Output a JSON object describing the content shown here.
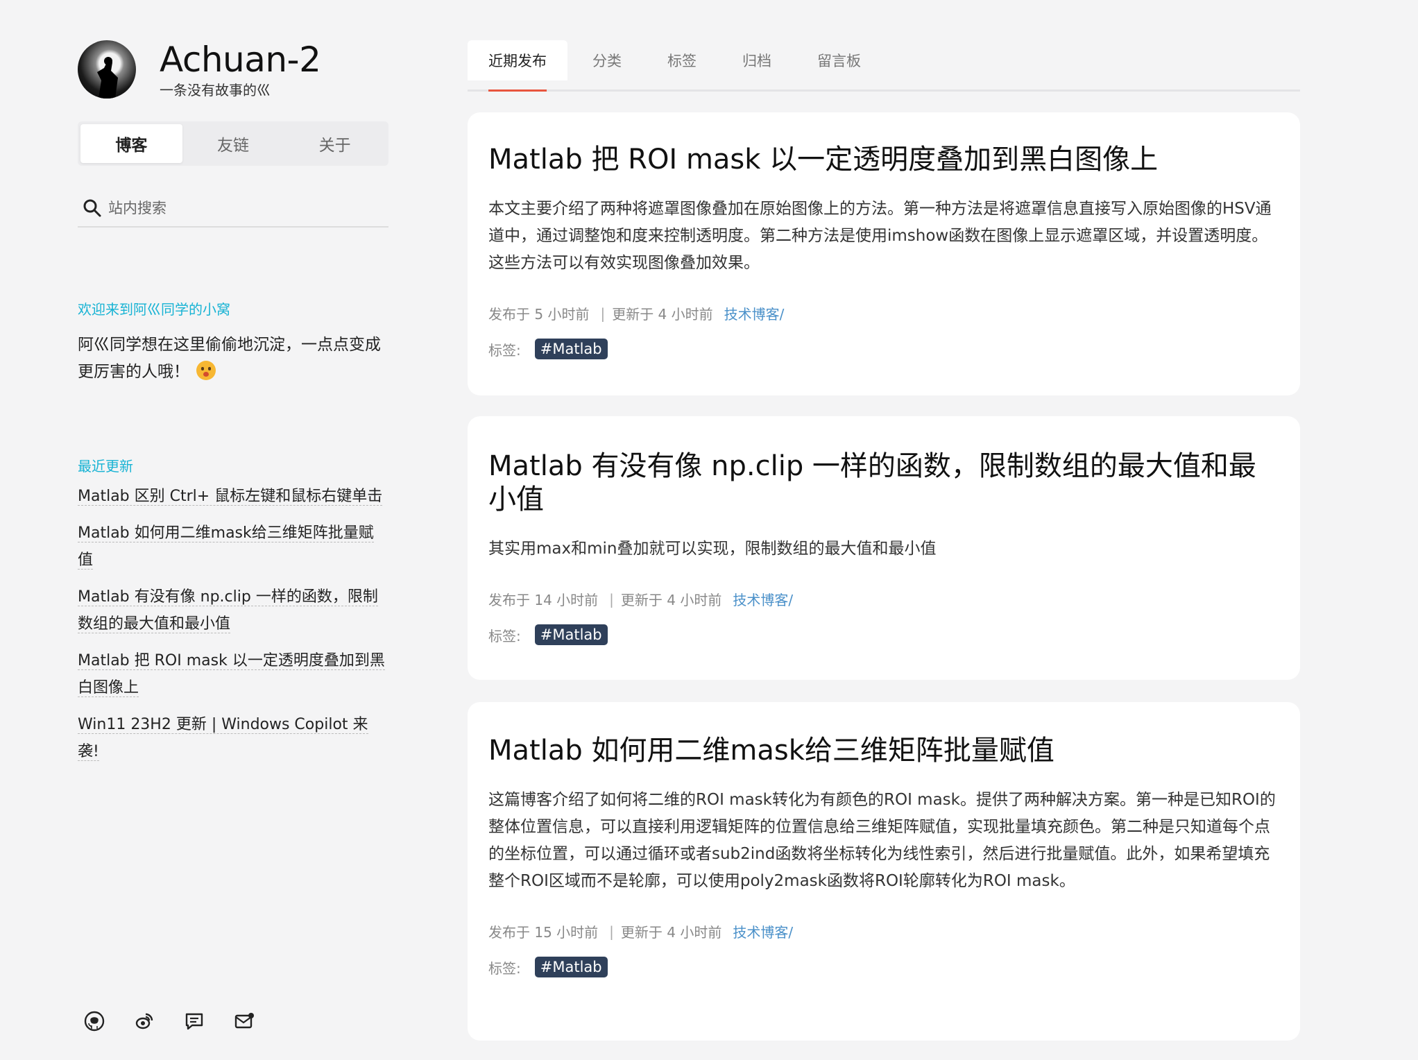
{
  "brand": {
    "title": "Achuan-2",
    "subtitle": "一条没有故事的巛"
  },
  "sidebar_nav": [
    "博客",
    "友链",
    "关于"
  ],
  "search": {
    "placeholder": "站内搜索"
  },
  "welcome": {
    "heading": "欢迎来到阿巛同学的小窝",
    "text": "阿巛同学想在这里偷偷地沉淀，一点点变成更厉害的人哦！"
  },
  "recent": {
    "heading": "最近更新",
    "items": [
      "Matlab 区别 Ctrl+ 鼠标左键和鼠标右键单击",
      "Matlab 如何用二维mask给三维矩阵批量赋值",
      "Matlab 有没有像 np.clip 一样的函数，限制数组的最大值和最小值",
      "Matlab 把 ROI mask 以一定透明度叠加到黑白图像上",
      "Win11 23H2 更新 | Windows Copilot 来袭!"
    ]
  },
  "social_icons": [
    "github-icon",
    "weibo-icon",
    "comment-icon",
    "mail-icon"
  ],
  "top_tabs": [
    "近期发布",
    "分类",
    "标签",
    "归档",
    "留言板"
  ],
  "labels": {
    "published_prefix": "发布于",
    "updated_prefix": "更新于",
    "tags_label": "标签:"
  },
  "posts": [
    {
      "title": "Matlab 把 ROI mask 以一定透明度叠加到黑白图像上",
      "excerpt": "本文主要介绍了两种将遮罩图像叠加在原始图像上的方法。第一种方法是将遮罩信息直接写入原始图像的HSV通道中，通过调整饱和度来控制透明度。第二种方法是使用imshow函数在图像上显示遮罩区域，并设置透明度。这些方法可以有效实现图像叠加效果。",
      "published": "发布于 5 小时前",
      "updated": "更新于 4 小时前",
      "category": "技术博客/",
      "tag": "#Matlab"
    },
    {
      "title": "Matlab 有没有像 np.clip 一样的函数，限制数组的最大值和最小值",
      "excerpt": "其实用max和min叠加就可以实现，限制数组的最大值和最小值",
      "published": "发布于 14 小时前",
      "updated": "更新于 4 小时前",
      "category": "技术博客/",
      "tag": "#Matlab"
    },
    {
      "title": "Matlab 如何用二维mask给三维矩阵批量赋值",
      "excerpt": "这篇博客介绍了如何将二维的ROI mask转化为有颜色的ROI mask。提供了两种解决方案。第一种是已知ROI的整体位置信息，可以直接利用逻辑矩阵的位置信息给三维矩阵赋值，实现批量填充颜色。第二种是只知道每个点的坐标位置，可以通过循环或者sub2ind函数将坐标转化为线性索引，然后进行批量赋值。此外，如果希望填充整个ROI区域而不是轮廓，可以使用poly2mask函数将ROI轮廓转化为ROI mask。",
      "published": "发布于 15 小时前",
      "updated": "更新于 4 小时前",
      "category": "技术博客/",
      "tag": "#Matlab"
    }
  ]
}
